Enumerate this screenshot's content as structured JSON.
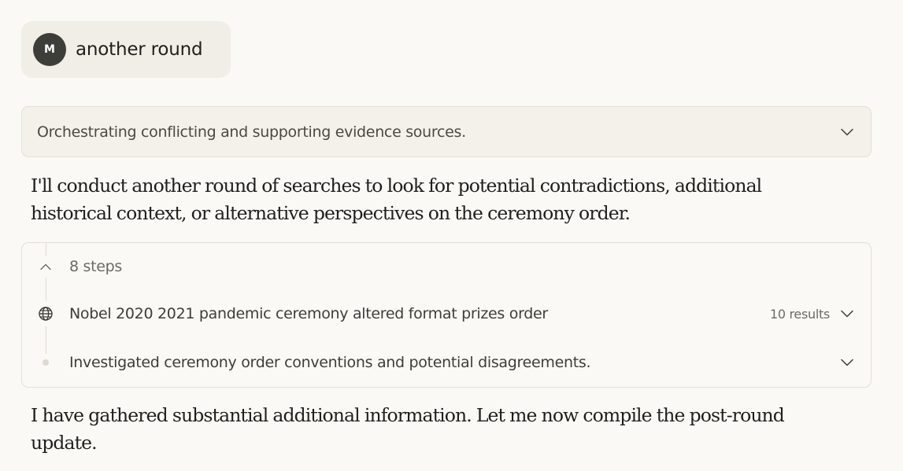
{
  "user_message": {
    "avatar_initial": "M",
    "text": "another round"
  },
  "thinking_block": {
    "label": "Orchestrating conflicting and supporting evidence sources.",
    "icon": "chevron-down-icon"
  },
  "assistant": {
    "paragraph_1": "I'll conduct another round of searches to look for potential contradictions, additional historical context, or alternative perspectives on the ceremony order.",
    "paragraph_2": "I have gathered substantial additional information. Let me now compile the post-round update."
  },
  "steps_panel": {
    "summary": "8 steps",
    "summary_icon": "chevron-up-icon",
    "items": [
      {
        "icon": "globe-icon",
        "text": "Nobel 2020 2021 pandemic ceremony altered format prizes order",
        "meta": "10 results",
        "expand_icon": "chevron-down-icon"
      },
      {
        "icon": "dot-icon",
        "text": "Investigated ceremony order conventions and potential disagreements.",
        "expand_icon": "chevron-down-icon"
      }
    ]
  },
  "colors": {
    "background": "#faf9f5",
    "bubble": "#f0eee6",
    "avatar": "#3d3d3a",
    "border": "#e3e0d5"
  }
}
